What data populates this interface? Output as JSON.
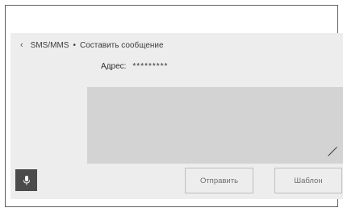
{
  "header": {
    "back_icon": "chevron-left-icon",
    "app": "SMS/MMS",
    "separator": "•",
    "title": "Составить сообщение"
  },
  "address": {
    "label": "Адрес:",
    "value": "*********"
  },
  "message": {
    "body": "",
    "edit_icon": "pencil-icon"
  },
  "buttons": {
    "mic_icon": "microphone-icon",
    "send": "Отправить",
    "template": "Шаблон"
  },
  "colors": {
    "background": "#ededed",
    "message_area": "#d3d3d3",
    "mic_button": "#4b4b4b"
  }
}
